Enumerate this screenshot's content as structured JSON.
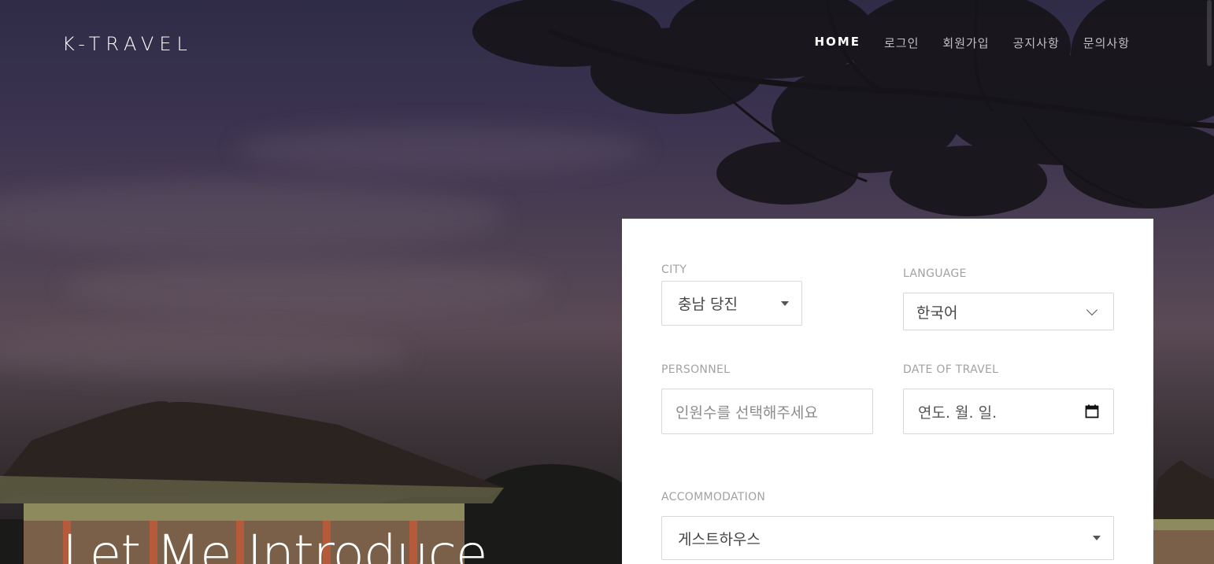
{
  "brand": "K-TRAVEL",
  "nav": {
    "items": [
      "HOME",
      "로그인",
      "회원가입",
      "공지사항",
      "문의사항"
    ],
    "active_index": 0
  },
  "hero": {
    "title": "Let Me Introduce"
  },
  "form": {
    "city": {
      "label": "CITY",
      "value": "충남 당진"
    },
    "language": {
      "label": "LANGUAGE",
      "value": "한국어"
    },
    "personnel": {
      "label": "PERSONNEL",
      "placeholder": "인원수를 선택해주세요"
    },
    "date": {
      "label": "DATE OF TRAVEL",
      "placeholder": "연도. 월. 일."
    },
    "accommodation": {
      "label": "ACCOMMODATION",
      "value": "게스트하우스"
    }
  },
  "colors": {
    "panel_bg": "#ffffff",
    "label": "#a2a2a2",
    "nav_active": "#ffffff"
  },
  "icons": {
    "dropdown": "caret-down-icon",
    "select_chevron": "chevron-down-icon",
    "calendar": "calendar-icon"
  }
}
